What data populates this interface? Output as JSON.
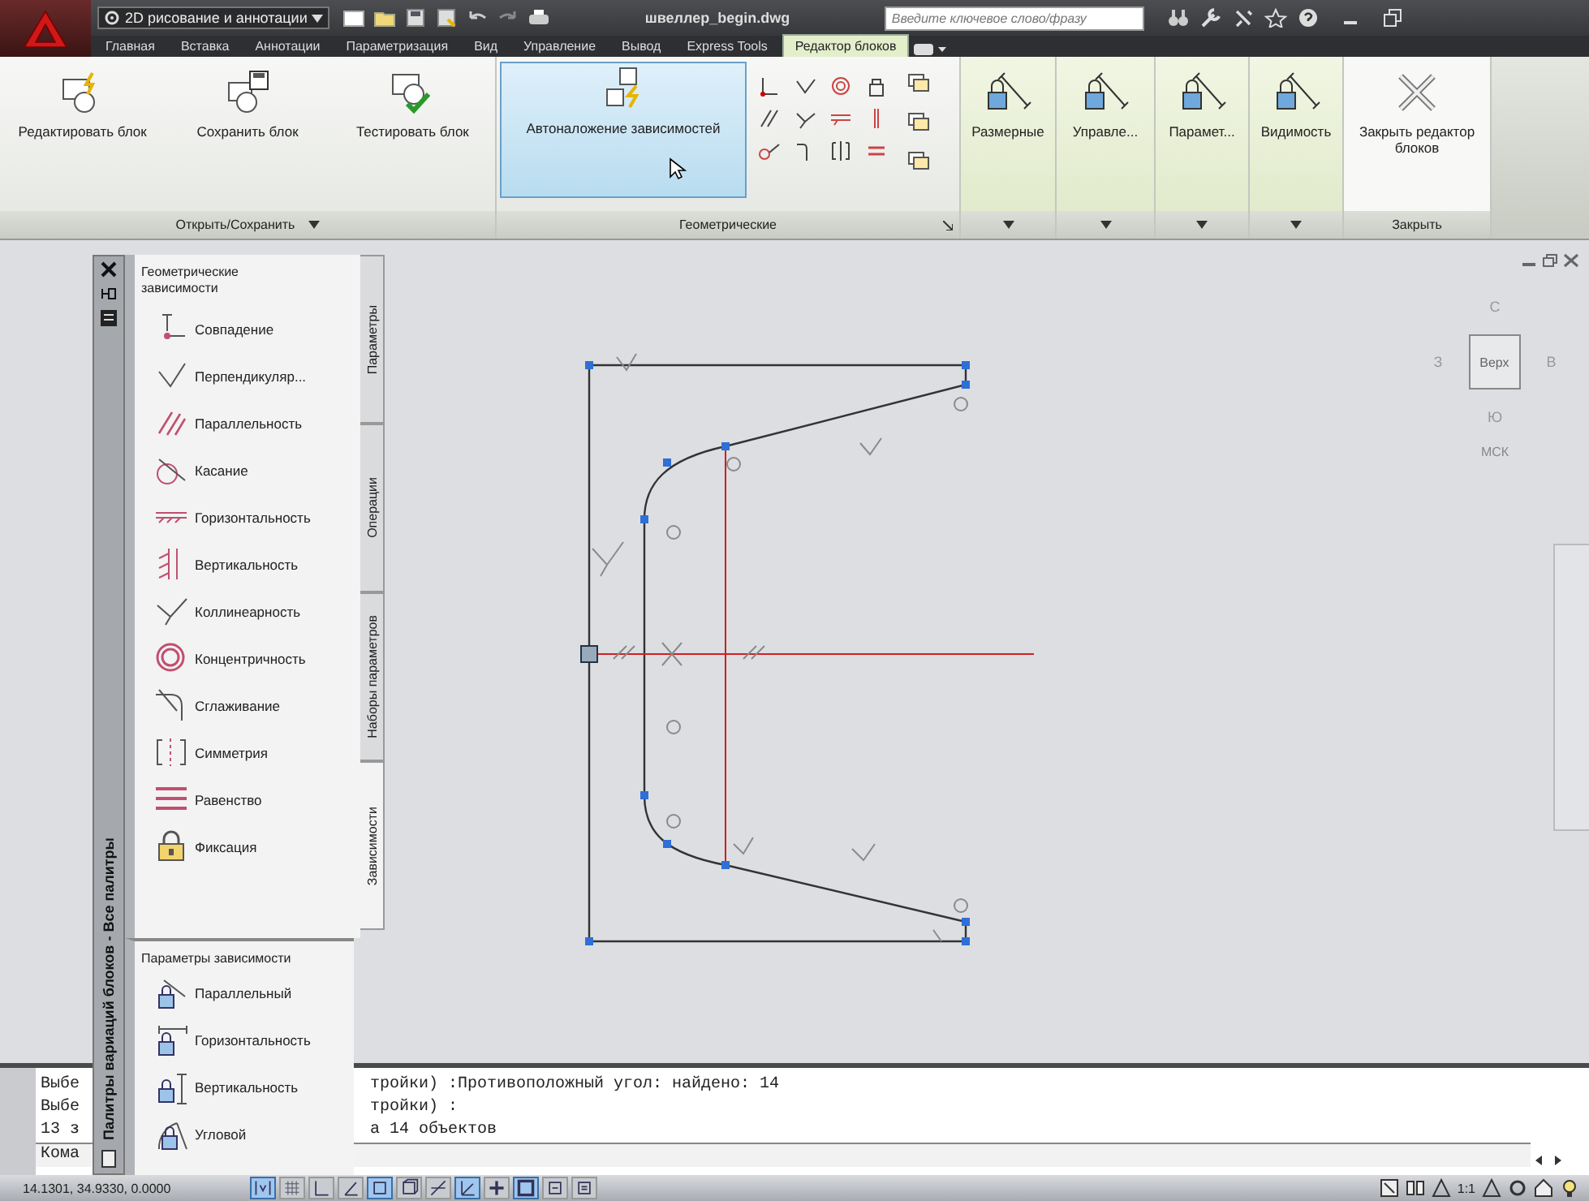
{
  "title_bar": {
    "workspace": "2D рисование и аннотации",
    "file_title": "швеллер_begin.dwg",
    "search_placeholder": "Введите ключевое слово/фразу"
  },
  "tabs": [
    {
      "label": "Главная",
      "selected": false
    },
    {
      "label": "Вставка",
      "selected": false
    },
    {
      "label": "Аннотации",
      "selected": false
    },
    {
      "label": "Параметризация",
      "selected": false
    },
    {
      "label": "Вид",
      "selected": false
    },
    {
      "label": "Управление",
      "selected": false
    },
    {
      "label": "Вывод",
      "selected": false
    },
    {
      "label": "Express Tools",
      "selected": false
    },
    {
      "label": "Редактор блоков",
      "selected": true
    }
  ],
  "ribbon": {
    "panels": [
      {
        "kind": "buttons",
        "title": "Открыть/Сохранить",
        "buttons": [
          {
            "label": "Редактировать блок",
            "hovered": false
          },
          {
            "label": "Сохранить блок",
            "hovered": false
          },
          {
            "label": "Тестировать блок",
            "hovered": false
          }
        ]
      },
      {
        "kind": "constraints",
        "title": "Геометрические",
        "buttons": [
          {
            "label": "Автоналожение зависимостей",
            "hovered": true
          }
        ]
      },
      {
        "kind": "dropdown",
        "buttons": [
          {
            "label": "Размерные",
            "hovered": false
          }
        ]
      },
      {
        "kind": "dropdown",
        "buttons": [
          {
            "label": "Управле...",
            "hovered": false
          }
        ]
      },
      {
        "kind": "dropdown",
        "buttons": [
          {
            "label": "Парамет...",
            "hovered": false
          }
        ]
      },
      {
        "kind": "dropdown",
        "buttons": [
          {
            "label": "Видимость",
            "hovered": false
          }
        ]
      },
      {
        "kind": "close",
        "title": "Закрыть",
        "buttons": [
          {
            "label": "Закрыть редактор блоков",
            "hovered": false
          }
        ]
      }
    ]
  },
  "viewcube": {
    "north": "С",
    "west": "З",
    "face": "Верх",
    "east": "В",
    "south": "Ю",
    "ucs": "МСК"
  },
  "palette": {
    "title": "Палитры вариаций блоков - Все палитры",
    "tabs": [
      {
        "label": "Параметры",
        "selected": false
      },
      {
        "label": "Операции",
        "selected": false
      },
      {
        "label": "Наборы параметров",
        "selected": false
      },
      {
        "label": "Зависимости",
        "selected": true
      }
    ],
    "sections": [
      {
        "title": "Геометрические зависимости",
        "items": [
          "Совпадение",
          "Перпендикуляр...",
          "Параллельность",
          "Касание",
          "Горизонтальность",
          "Вертикальность",
          "Коллинеарность",
          "Концентричность",
          "Сглаживание",
          "Симметрия",
          "Равенство",
          "Фиксация"
        ]
      },
      {
        "title": "Параметры зависимости",
        "items": [
          "Параллельный",
          "Горизонтальность",
          "Вертикальность",
          "Угловой"
        ]
      }
    ]
  },
  "command_line": {
    "lines": [
      {
        "start": "Выбе",
        "end": "тройки) :Противоположный угол: найдено: 14"
      },
      {
        "start": "Выбе",
        "end": "тройки) :"
      },
      {
        "start": "13 з",
        "end": "а 14 объектов"
      },
      {
        "start": "Кома"
      }
    ]
  },
  "status_bar": {
    "coordinates": "14.1301, 34.9330, 0.0000",
    "annotation_scale": "1:1",
    "toggles": [
      {
        "on": true
      },
      {
        "on": false
      },
      {
        "on": false
      },
      {
        "on": false
      },
      {
        "on": true
      },
      {
        "on": false
      },
      {
        "on": false
      },
      {
        "on": true
      },
      {
        "on": false
      },
      {
        "on": true
      },
      {
        "on": false
      },
      {
        "on": false
      }
    ]
  }
}
